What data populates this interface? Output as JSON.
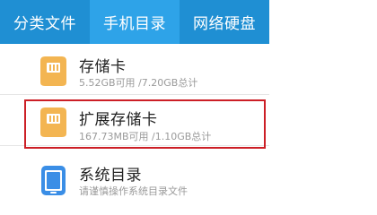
{
  "tabs": [
    {
      "label": "分类文件",
      "active": false
    },
    {
      "label": "手机目录",
      "active": true
    },
    {
      "label": "网络硬盘",
      "active": false
    }
  ],
  "items": [
    {
      "title": "存储卡",
      "subtitle": "5.52GB可用 /7.20GB总计",
      "icon": "sd-card-icon"
    },
    {
      "title": "扩展存储卡",
      "subtitle": "167.73MB可用 /1.10GB总计",
      "icon": "sd-card-icon",
      "highlighted": true
    },
    {
      "title": "系统目录",
      "subtitle": "请谨慎操作系统目录文件",
      "icon": "phone-icon"
    }
  ],
  "colors": {
    "tabbar": "#1f8fd3",
    "active_tab": "#2ea3e8",
    "card_icon": "#f3b552",
    "phone_icon": "#3a8ee6",
    "highlight": "#cc1f26"
  }
}
